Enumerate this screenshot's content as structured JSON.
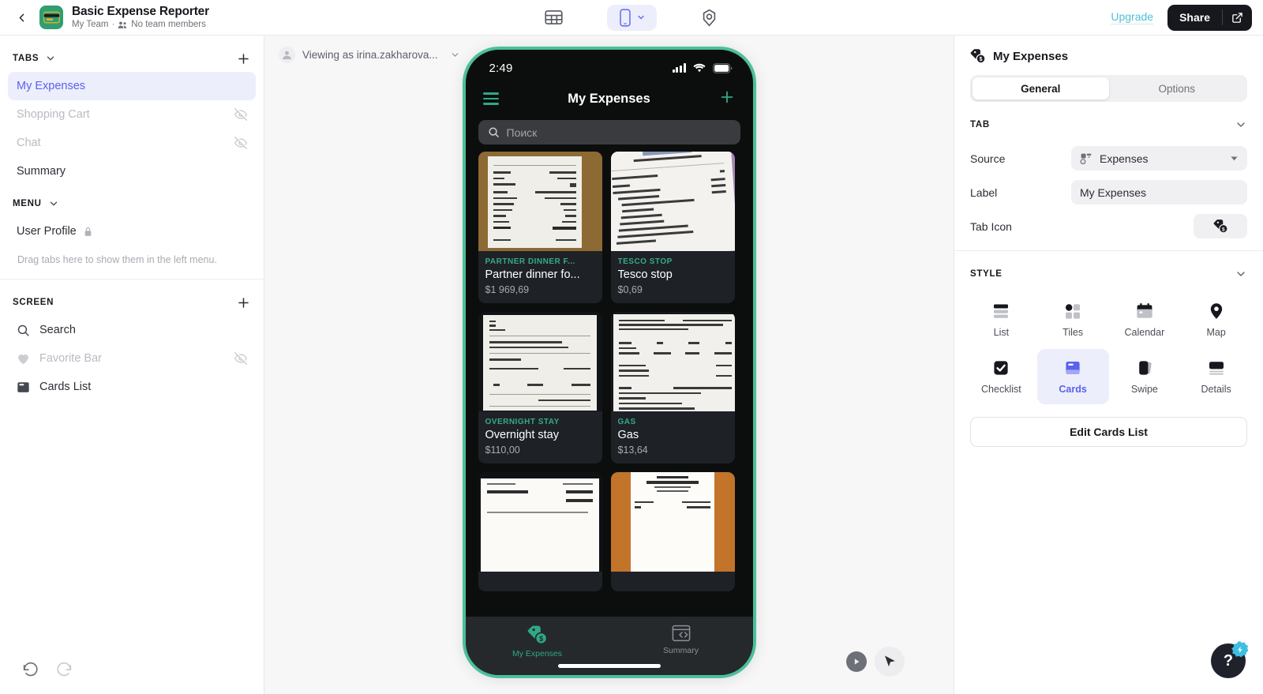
{
  "topbar": {
    "back_icon": "chevron-left-icon",
    "app_icon": "credit-card-icon",
    "app_title": "Basic Expense Reporter",
    "team_name": "My Team",
    "separator": "·",
    "members_text": "No team members",
    "members_icon": "people-icon",
    "table_view_icon": "table-icon",
    "device_icon": "mobile-icon",
    "device_caret_icon": "chevron-down-icon",
    "settings_icon": "gear-icon",
    "upgrade_label": "Upgrade",
    "share_label": "Share",
    "share_external_icon": "external-link-icon"
  },
  "sidebar": {
    "tabs_section": {
      "title": "TABS",
      "caret_icon": "chevron-down-icon",
      "add_icon": "plus-icon",
      "items": [
        {
          "label": "My Expenses",
          "state": "active",
          "hidden_icon": null
        },
        {
          "label": "Shopping Cart",
          "state": "muted",
          "hidden_icon": "eye-off-icon"
        },
        {
          "label": "Chat",
          "state": "muted",
          "hidden_icon": "eye-off-icon"
        },
        {
          "label": "Summary",
          "state": "normal",
          "hidden_icon": null
        }
      ]
    },
    "menu_section": {
      "title": "MENU",
      "caret_icon": "chevron-down-icon",
      "items": [
        {
          "label": "User Profile",
          "lock_icon": "lock-icon"
        }
      ],
      "hint": "Drag tabs here to show them in the left menu."
    },
    "screen_section": {
      "title": "SCREEN",
      "add_icon": "plus-icon",
      "items": [
        {
          "label": "Search",
          "icon": "search-icon",
          "state": "normal",
          "hidden_icon": null
        },
        {
          "label": "Favorite Bar",
          "icon": "heart-icon",
          "state": "muted",
          "hidden_icon": "eye-off-icon"
        },
        {
          "label": "Cards List",
          "icon": "cards-icon",
          "state": "normal",
          "hidden_icon": null
        }
      ]
    },
    "footer": {
      "undo_icon": "undo-icon",
      "redo_icon": "redo-icon"
    }
  },
  "canvas": {
    "viewing_as": "Viewing as irina.zakharova...",
    "viewing_avatar_icon": "user-avatar-icon",
    "viewing_caret_icon": "chevron-down-icon",
    "play_icon": "play-icon",
    "cursor_icon": "cursor-arrow-icon",
    "frame_color": "#4cbf9b"
  },
  "phone": {
    "status": {
      "time": "2:49",
      "signal_icon": "cellular-signal-icon",
      "wifi_icon": "wifi-icon",
      "battery_icon": "battery-full-icon"
    },
    "header": {
      "menu_icon": "hamburger-menu-icon",
      "title": "My Expenses",
      "add_icon": "plus-icon"
    },
    "search": {
      "icon": "search-icon",
      "placeholder": "Поиск"
    },
    "accent_color": "#2fa887",
    "cards": [
      {
        "category": "PARTNER DINNER F...",
        "name": "Partner dinner fo...",
        "amount": "$1 969,69",
        "image": "receipt-photo-wood-table"
      },
      {
        "category": "TESCO STOP",
        "name": "Tesco stop",
        "amount": "$0,69",
        "image": "receipt-photo-tesco"
      },
      {
        "category": "OVERNIGHT STAY",
        "name": "Overnight stay",
        "amount": "$110,00",
        "image": "receipt-photo-hotel"
      },
      {
        "category": "GAS",
        "name": "Gas",
        "amount": "$13,64",
        "image": "receipt-photo-fuel"
      },
      {
        "category": "",
        "name": "",
        "amount": "",
        "image": "receipt-photo-order"
      },
      {
        "category": "",
        "name": "",
        "amount": "",
        "image": "receipt-photo-berghotel"
      }
    ],
    "tabbar": [
      {
        "label": "My Expenses",
        "icon": "price-tag-dollar-icon",
        "selected": true
      },
      {
        "label": "Summary",
        "icon": "summary-window-icon",
        "selected": false
      }
    ]
  },
  "right_panel": {
    "title": "My Expenses",
    "title_icon": "price-tag-dollar-icon",
    "tabs": [
      {
        "label": "General",
        "active": true
      },
      {
        "label": "Options",
        "active": false
      }
    ],
    "tab_group": {
      "title": "TAB",
      "caret_icon": "chevron-down-icon",
      "fields": [
        {
          "label": "Source",
          "value": "Expenses",
          "control": "select",
          "icon": "data-source-icon",
          "caret_icon": "caret-down-icon"
        },
        {
          "label": "Label",
          "value": "My Expenses",
          "control": "text"
        },
        {
          "label": "Tab Icon",
          "value": "",
          "control": "icon-picker",
          "icon": "price-tag-dollar-icon"
        }
      ]
    },
    "style_group": {
      "title": "STYLE",
      "caret_icon": "chevron-down-icon",
      "options": [
        {
          "label": "List",
          "icon": "list-layout-icon",
          "selected": false
        },
        {
          "label": "Tiles",
          "icon": "tiles-layout-icon",
          "selected": false
        },
        {
          "label": "Calendar",
          "icon": "calendar-layout-icon",
          "selected": false
        },
        {
          "label": "Map",
          "icon": "map-pin-layout-icon",
          "selected": false
        },
        {
          "label": "Checklist",
          "icon": "checklist-layout-icon",
          "selected": false
        },
        {
          "label": "Cards",
          "icon": "cards-layout-icon",
          "selected": true
        },
        {
          "label": "Swipe",
          "icon": "swipe-layout-icon",
          "selected": false
        },
        {
          "label": "Details",
          "icon": "details-layout-icon",
          "selected": false
        }
      ],
      "edit_button": "Edit Cards List"
    },
    "help": {
      "label": "?",
      "badge_icon": "lightning-bolt-icon"
    },
    "accent_color": "#5a62ef"
  }
}
